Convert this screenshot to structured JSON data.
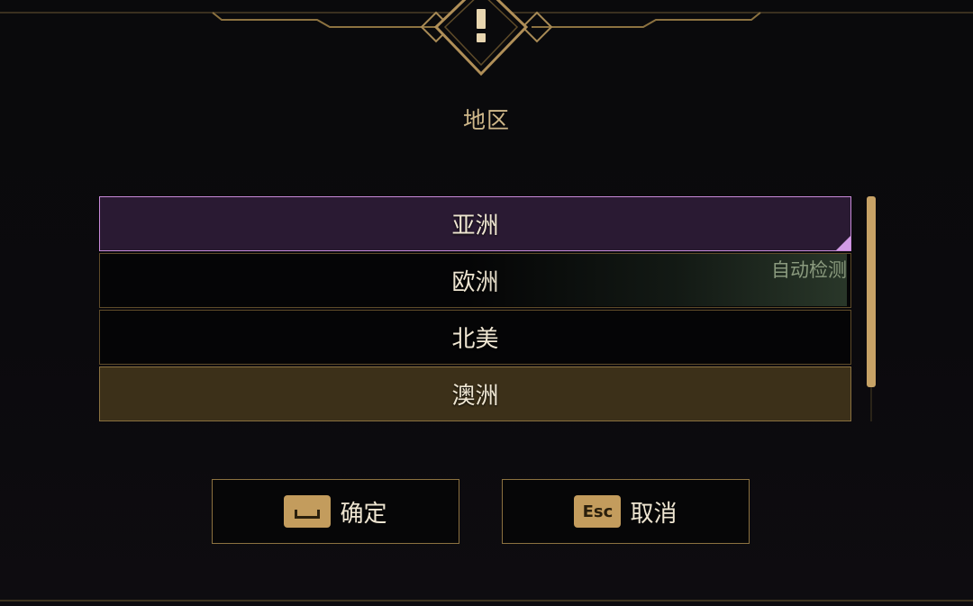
{
  "dialog": {
    "icon": "exclamation-icon",
    "title": "地区"
  },
  "regions": [
    {
      "label": "亚洲",
      "state": "selected"
    },
    {
      "label": "欧洲",
      "state": "normal"
    },
    {
      "label": "北美",
      "state": "normal"
    },
    {
      "label": "澳洲",
      "state": "hover"
    }
  ],
  "auto_detect_label": "自动检测",
  "buttons": {
    "confirm": {
      "key_icon": "space-key-icon",
      "label": "确定"
    },
    "cancel": {
      "key_label": "Esc",
      "label": "取消"
    }
  },
  "colors": {
    "gold": "#c39c5d",
    "selected_border": "#c88ad9",
    "selected_bg": "#2a1a33",
    "hover_bg": "#3c3019"
  }
}
